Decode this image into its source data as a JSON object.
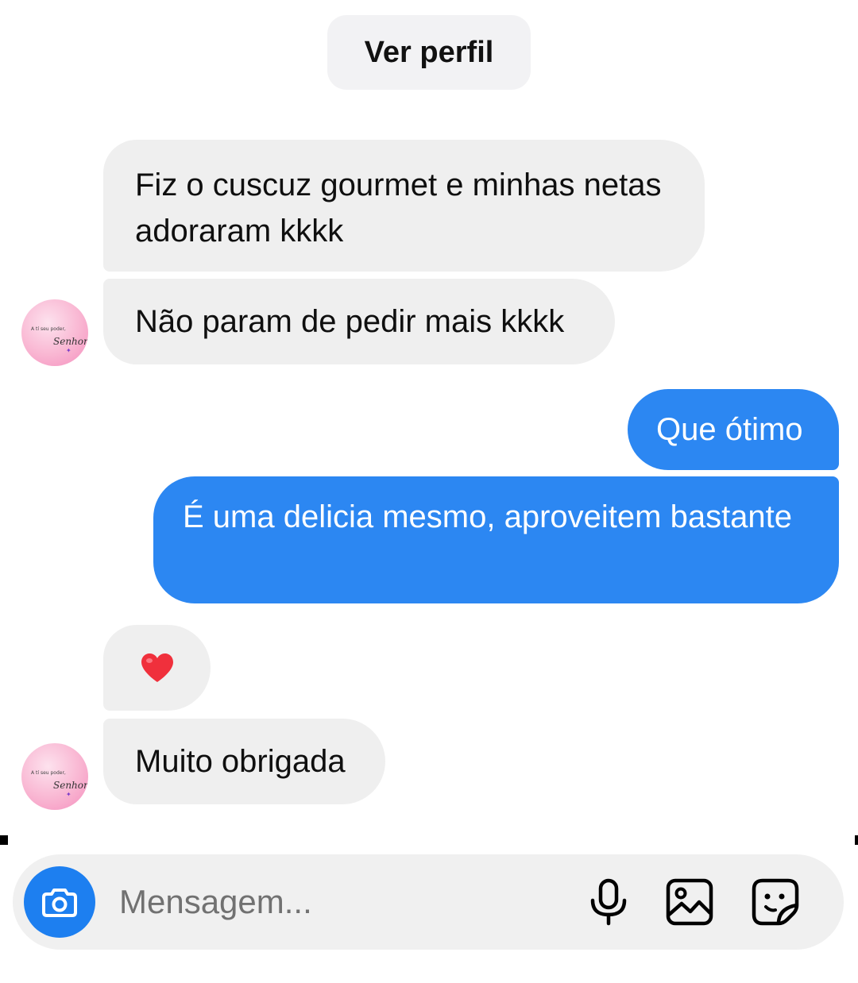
{
  "header": {
    "view_profile_label": "Ver perfil"
  },
  "messages": [
    {
      "direction": "incoming",
      "text": "Fiz o cuscuz gourmet e minhas netas adoraram kkkk"
    },
    {
      "direction": "incoming",
      "text": "Não param de pedir mais kkkk"
    },
    {
      "direction": "outgoing",
      "text": "Que ótimo"
    },
    {
      "direction": "outgoing",
      "text": "É uma delicia mesmo, aproveitem bastante"
    },
    {
      "direction": "incoming",
      "text": "",
      "icon": "heart-icon"
    },
    {
      "direction": "incoming",
      "text": "Muito obrigada"
    }
  ],
  "avatar": {
    "line1": "A tí seu poder,",
    "line2": "Senhor!"
  },
  "composer": {
    "placeholder": "Mensagem...",
    "icons": [
      "camera-icon",
      "microphone-icon",
      "gallery-icon",
      "sticker-icon"
    ]
  },
  "colors": {
    "outgoing_bubble": "#2c87f2",
    "incoming_bubble": "#efefef",
    "camera_button": "#1d7ff0",
    "heart": "#f0303c"
  }
}
